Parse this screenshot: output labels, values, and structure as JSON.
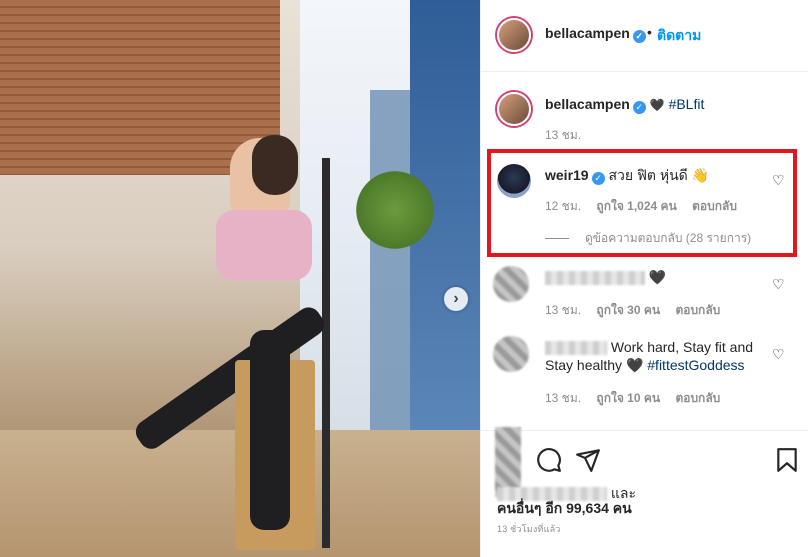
{
  "post": {
    "username": "bellacampen",
    "separator": "•",
    "follow_label": "ติดตาม",
    "caption_emoji": "🖤",
    "caption_tag": "#BLfit",
    "caption_time": "13 ชม."
  },
  "comments": [
    {
      "username": "weir19",
      "text": "สวย ฟิต หุ่นดี 👋",
      "time": "12 ชม.",
      "likes": "ถูกใจ 1,024 คน",
      "reply": "ตอบกลับ",
      "view_replies": "ดูข้อความตอบกลับ (28 รายการ)"
    },
    {
      "username_hidden": true,
      "text": "🖤",
      "time": "13 ชม.",
      "likes": "ถูกใจ 30 คน",
      "reply": "ตอบกลับ"
    },
    {
      "username_hidden": true,
      "text": "Work hard, Stay fit and Stay healthy 🖤",
      "tag": "#fittestGoddess",
      "time": "13 ชม.",
      "likes": "ถูกใจ 10 คน",
      "reply": "ตอบกลับ"
    }
  ],
  "likes_summary": {
    "and": "และ",
    "others": "คนอื่นๆ อีก 99,634 คน",
    "time_ago": "13 ชั่วโมงที่แล้ว"
  },
  "icons": [
    "heart-icon",
    "comment-icon",
    "share-icon",
    "bookmark-icon",
    "verified-icon",
    "next-arrow-icon"
  ],
  "colors": {
    "accent": "#0095f6",
    "highlight": "#e4151d",
    "tag": "#00376b",
    "muted": "#8e8e8e"
  }
}
